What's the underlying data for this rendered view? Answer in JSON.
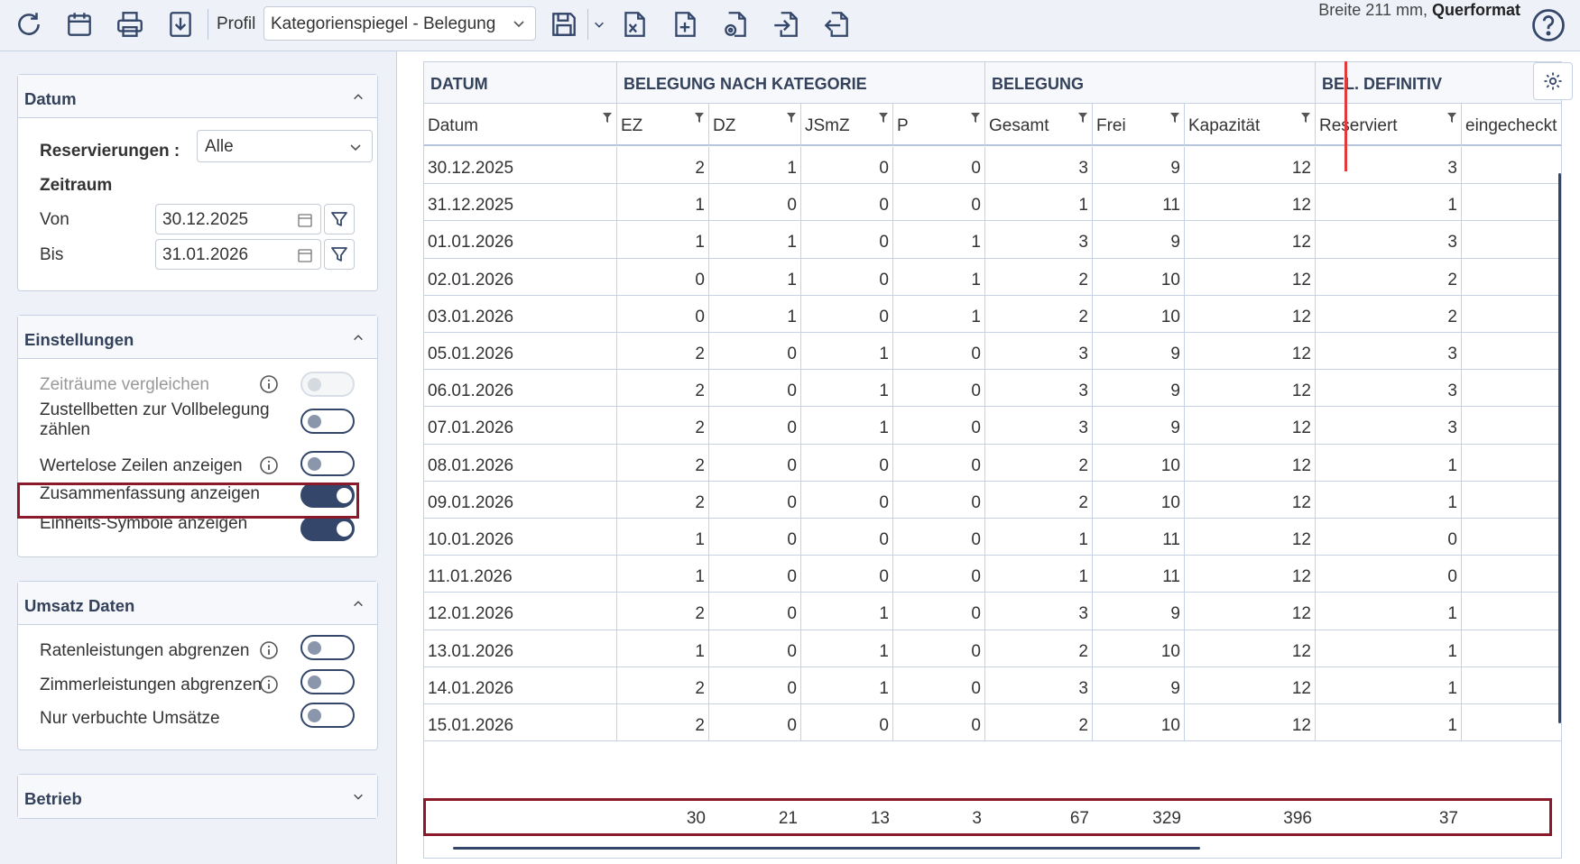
{
  "toolbar": {
    "icons": [
      "refresh-icon",
      "calendar-icon",
      "print-icon",
      "download-icon",
      "save-icon",
      "chevron-down-icon",
      "export-excel-icon",
      "add-document-icon",
      "document-settings-icon",
      "import-icon",
      "export-icon",
      "help-icon"
    ],
    "profil_label": "Profil",
    "profil_value": "Kategorienspiegel - Belegung",
    "format_prefix": "Breite 211 mm,",
    "format_value": "Querformat"
  },
  "datum_card": {
    "title": "Datum",
    "reservierungen_label": "Reservierungen :",
    "reservierungen_value": "Alle",
    "zeitraum_label": "Zeitraum",
    "von_label": "Von",
    "von_value": "30.12.2025",
    "bis_label": "Bis",
    "bis_value": "31.01.2026"
  },
  "einstellungen_card": {
    "title": "Einstellungen",
    "zeitraeume": {
      "label": "Zeiträume vergleichen",
      "state": "disabled"
    },
    "zustellbetten": {
      "label1": "Zustellbetten zur Vollbelegung",
      "label2": "zählen",
      "state": "off"
    },
    "wertelose": {
      "label": "Wertelose Zeilen anzeigen",
      "state": "off"
    },
    "zusammenfassung": {
      "label": "Zusammenfassung anzeigen",
      "state": "on"
    },
    "einheits": {
      "label": "Einheits-Symbole anzeigen",
      "state": "on"
    }
  },
  "umsatz_card": {
    "title": "Umsatz Daten",
    "raten": {
      "label": "Ratenleistungen abgrenzen",
      "state": "off"
    },
    "zimmer": {
      "label": "Zimmerleistungen abgrenzen",
      "state": "off"
    },
    "verbucht": {
      "label": "Nur verbuchte Umsätze",
      "state": "off"
    }
  },
  "betrieb_card": {
    "title": "Betrieb"
  },
  "colors": {
    "accent": "#34476a",
    "highlight": "#8a1a2a",
    "marker": "#e03a3a"
  },
  "table": {
    "groups": [
      "DATUM",
      "BELEGUNG NACH KATEGORIE",
      "BELEGUNG",
      "BEL. DEFINITIV"
    ],
    "columns": [
      "Datum",
      "EZ",
      "DZ",
      "JSmZ",
      "P",
      "Gesamt",
      "Frei",
      "Kapazität",
      "Reserviert",
      "eingecheckt"
    ],
    "rows": [
      [
        "30.12.2025",
        "2",
        "1",
        "0",
        "0",
        "3",
        "9",
        "12",
        "3",
        ""
      ],
      [
        "31.12.2025",
        "1",
        "0",
        "0",
        "0",
        "1",
        "11",
        "12",
        "1",
        ""
      ],
      [
        "01.01.2026",
        "1",
        "1",
        "0",
        "1",
        "3",
        "9",
        "12",
        "3",
        ""
      ],
      [
        "02.01.2026",
        "0",
        "1",
        "0",
        "1",
        "2",
        "10",
        "12",
        "2",
        ""
      ],
      [
        "03.01.2026",
        "0",
        "1",
        "0",
        "1",
        "2",
        "10",
        "12",
        "2",
        ""
      ],
      [
        "05.01.2026",
        "2",
        "0",
        "1",
        "0",
        "3",
        "9",
        "12",
        "3",
        ""
      ],
      [
        "06.01.2026",
        "2",
        "0",
        "1",
        "0",
        "3",
        "9",
        "12",
        "3",
        ""
      ],
      [
        "07.01.2026",
        "2",
        "0",
        "1",
        "0",
        "3",
        "9",
        "12",
        "3",
        ""
      ],
      [
        "08.01.2026",
        "2",
        "0",
        "0",
        "0",
        "2",
        "10",
        "12",
        "1",
        ""
      ],
      [
        "09.01.2026",
        "2",
        "0",
        "0",
        "0",
        "2",
        "10",
        "12",
        "1",
        ""
      ],
      [
        "10.01.2026",
        "1",
        "0",
        "0",
        "0",
        "1",
        "11",
        "12",
        "0",
        ""
      ],
      [
        "11.01.2026",
        "1",
        "0",
        "0",
        "0",
        "1",
        "11",
        "12",
        "0",
        ""
      ],
      [
        "12.01.2026",
        "2",
        "0",
        "1",
        "0",
        "3",
        "9",
        "12",
        "1",
        ""
      ],
      [
        "13.01.2026",
        "1",
        "0",
        "1",
        "0",
        "2",
        "10",
        "12",
        "1",
        ""
      ],
      [
        "14.01.2026",
        "2",
        "0",
        "1",
        "0",
        "3",
        "9",
        "12",
        "1",
        ""
      ],
      [
        "15.01.2026",
        "2",
        "0",
        "0",
        "0",
        "2",
        "10",
        "12",
        "1",
        ""
      ]
    ],
    "summary": [
      "",
      "30",
      "21",
      "13",
      "3",
      "67",
      "329",
      "396",
      "37",
      ""
    ]
  }
}
